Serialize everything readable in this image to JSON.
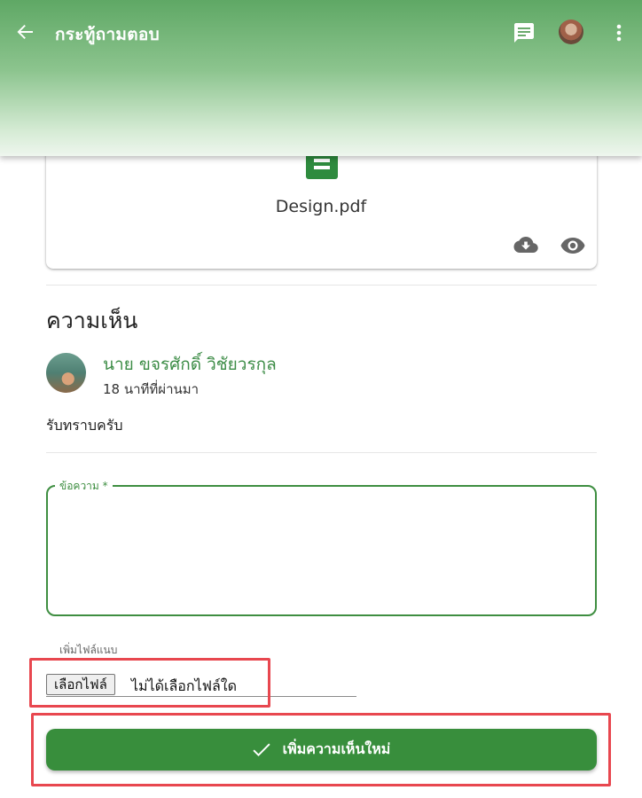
{
  "appbar": {
    "title": "กระทู้ถามตอบ",
    "back_icon": "arrow-left-icon",
    "chat_icon": "chat-icon",
    "more_icon": "more-vert-icon"
  },
  "attachment": {
    "file_name": "Design.pdf",
    "file_icon": "document-icon",
    "download_icon": "cloud-download-icon",
    "view_icon": "eye-icon"
  },
  "comments": {
    "section_title": "ความเห็น",
    "items": [
      {
        "author": "นาย ขจรศักดิ์ วิชัยวรกุล",
        "time": "18 นาทีที่ผ่านมา",
        "text": "รับทราบครับ"
      }
    ]
  },
  "form": {
    "message_label": "ข้อความ *",
    "message_value": "",
    "attach_label": "เพิ่มไฟล์แนบ",
    "choose_file_label": "เลือกไฟล์",
    "no_file_text": "ไม่ได้เลือกไฟล์ใด",
    "submit_label": "เพิ่มความเห็นใหม่",
    "submit_icon": "check-icon"
  },
  "colors": {
    "primary": "#388e3c",
    "author": "#3c8c46",
    "highlight": "#e8474f"
  }
}
